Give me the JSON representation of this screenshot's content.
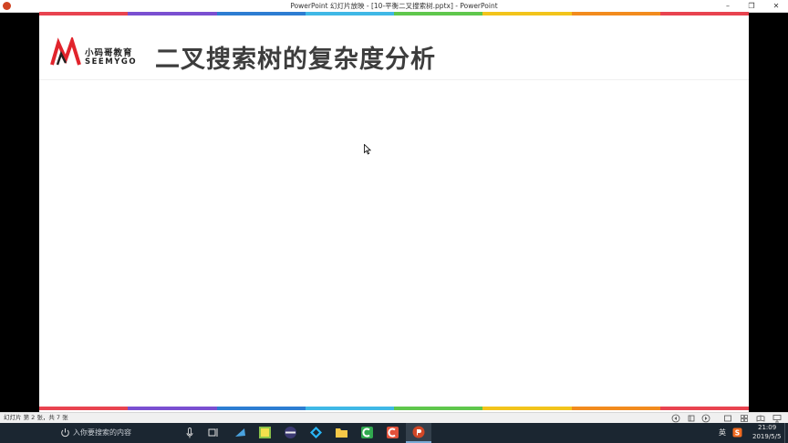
{
  "window": {
    "title": "PowerPoint 幻灯片放映 - [10-平衡二叉搜索树.pptx] - PowerPoint"
  },
  "slide": {
    "logo": {
      "cn": "小码哥教育",
      "en": "SEEMYGO"
    },
    "title": "二叉搜索树的复杂度分析",
    "rainbow_colors": [
      "#e8434f",
      "#7a4fd1",
      "#2d7dd2",
      "#3fb8e6",
      "#5fc74c",
      "#f2c41b",
      "#f28b1e",
      "#e8434f"
    ]
  },
  "status_bar": {
    "slide_info": "幻灯片 第 2 张，共 7 张"
  },
  "taskbar": {
    "search_placeholder": "入你要搜索的内容",
    "tray": {
      "ime": "英",
      "time": "21:09",
      "date": "2019/5/5"
    }
  }
}
